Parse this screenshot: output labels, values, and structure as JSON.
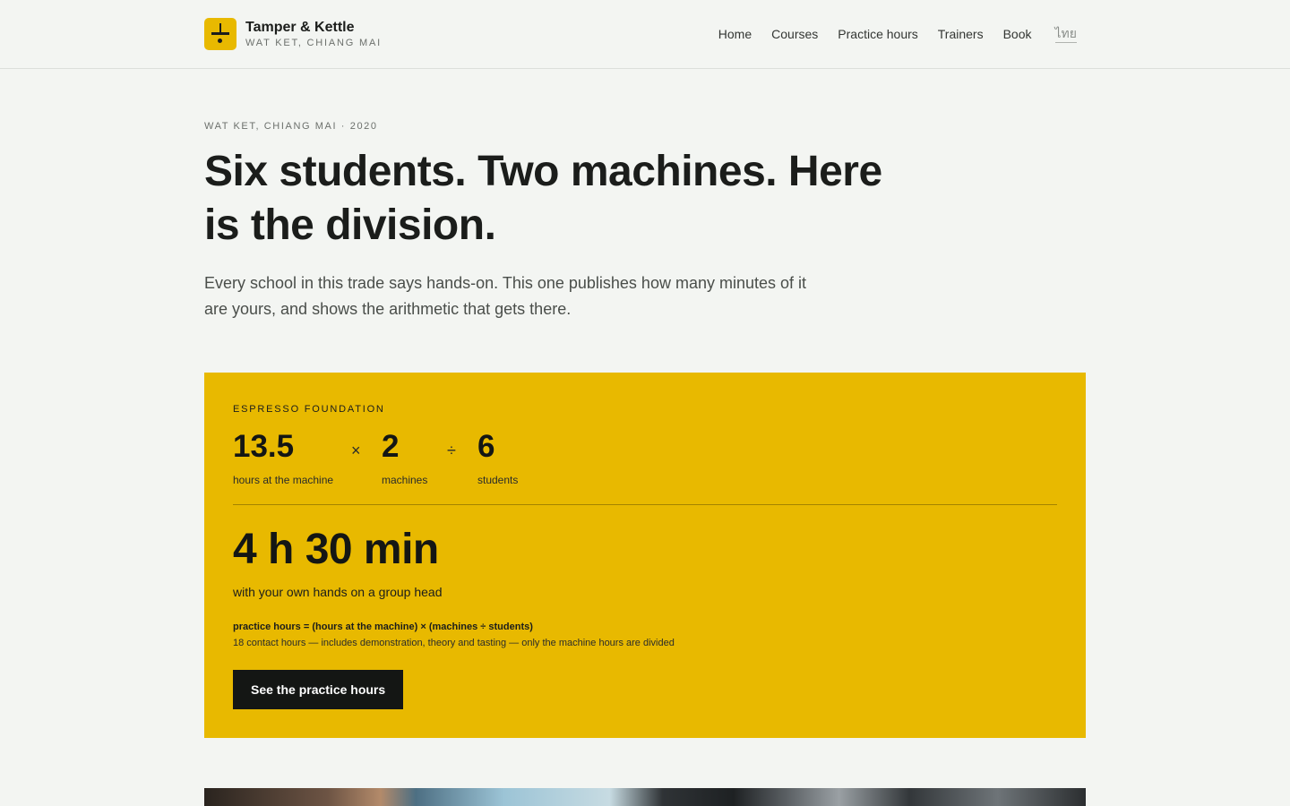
{
  "header": {
    "brand_name": "Tamper & Kettle",
    "brand_sub": "WAT KET, CHIANG MAI",
    "nav": [
      "Home",
      "Courses",
      "Practice hours",
      "Trainers",
      "Book"
    ],
    "lang": "ไทย"
  },
  "hero": {
    "eyebrow": "WAT KET, CHIANG MAI · 2020",
    "headline": "Six students. Two machines. Here is the division.",
    "lede": "Every school in this trade says hands-on. This one publishes how many minutes of it are yours, and shows the arithmetic that gets there."
  },
  "calc": {
    "eyebrow": "ESPRESSO FOUNDATION",
    "terms": [
      {
        "value": "13.5",
        "caption": "hours at the machine"
      },
      {
        "value": "2",
        "caption": "machines"
      },
      {
        "value": "6",
        "caption": "students"
      }
    ],
    "ops": [
      "×",
      "÷"
    ],
    "result": "4 h 30 min",
    "result_caption": "with your own hands on a group head",
    "formula": "practice hours = (hours at the machine) × (machines ÷ students)",
    "formula_note": "18 contact hours — includes demonstration, theory and tasting — only the machine hours are divided",
    "cta": "See the practice hours"
  },
  "colors": {
    "accent": "#e8b900",
    "dark": "#141614",
    "background": "#f3f5f2"
  }
}
